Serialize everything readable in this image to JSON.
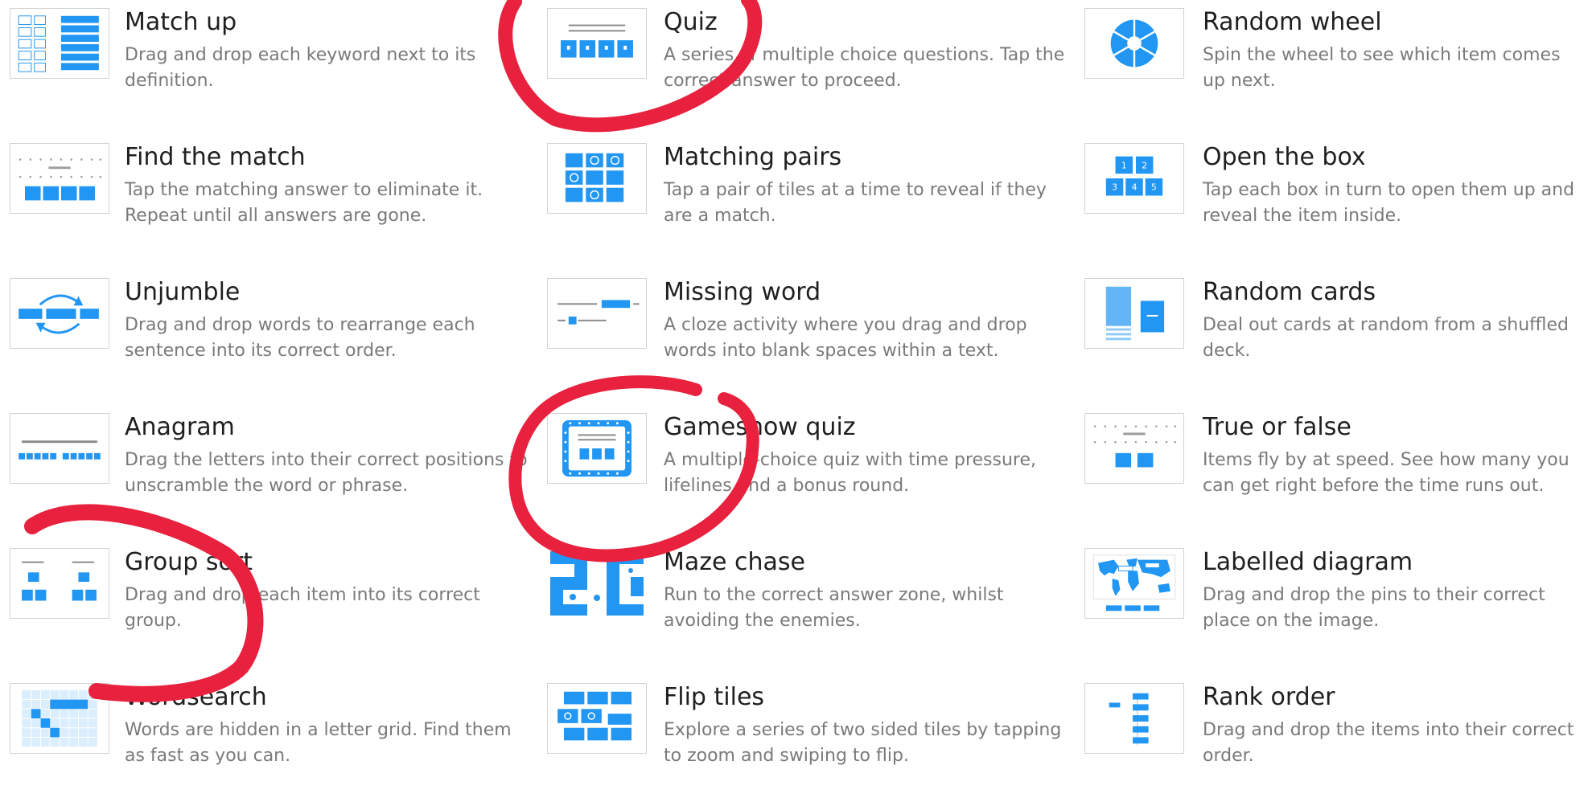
{
  "accent_color": "#2196f3",
  "annotation_color": "#e8213e",
  "templates": [
    {
      "title": "Match up",
      "description": "Drag and drop each keyword next to its definition.",
      "thumbnail": "match-up-thumbnail"
    },
    {
      "title": "Find the match",
      "description": "Tap the matching answer to eliminate it. Repeat until all answers are gone.",
      "thumbnail": "find-the-match-thumbnail"
    },
    {
      "title": "Unjumble",
      "description": "Drag and drop words to rearrange each sentence into its correct order.",
      "thumbnail": "unjumble-thumbnail"
    },
    {
      "title": "Anagram",
      "description": "Drag the letters into their correct positions to unscramble the word or phrase.",
      "thumbnail": "anagram-thumbnail"
    },
    {
      "title": "Group sort",
      "description": "Drag and drop each item into its correct group.",
      "thumbnail": "group-sort-thumbnail"
    },
    {
      "title": "Wordsearch",
      "description": "Words are hidden in a letter grid. Find them as fast as you can.",
      "thumbnail": "wordsearch-thumbnail"
    },
    {
      "title": "Quiz",
      "description": "A series of multiple choice questions. Tap the correct answer to proceed.",
      "thumbnail": "quiz-thumbnail"
    },
    {
      "title": "Matching pairs",
      "description": "Tap a pair of tiles at a time to reveal if they are a match.",
      "thumbnail": "matching-pairs-thumbnail"
    },
    {
      "title": "Missing word",
      "description": "A cloze activity where you drag and drop words into blank spaces within a text.",
      "thumbnail": "missing-word-thumbnail"
    },
    {
      "title": "Gameshow quiz",
      "description": "A multiple-choice quiz with time pressure, lifelines and a bonus round.",
      "thumbnail": "gameshow-quiz-thumbnail"
    },
    {
      "title": "Maze chase",
      "description": "Run to the correct answer zone, whilst avoiding the enemies.",
      "thumbnail": "maze-chase-thumbnail"
    },
    {
      "title": "Flip tiles",
      "description": "Explore a series of two sided tiles by tapping to zoom and swiping to flip.",
      "thumbnail": "flip-tiles-thumbnail"
    },
    {
      "title": "Random wheel",
      "description": "Spin the wheel to see which item comes up next.",
      "thumbnail": "random-wheel-thumbnail"
    },
    {
      "title": "Open the box",
      "description": "Tap each box in turn to open them up and reveal the item inside.",
      "thumbnail": "open-the-box-thumbnail",
      "box_numbers": [
        "1",
        "2",
        "3",
        "4",
        "5"
      ]
    },
    {
      "title": "Random cards",
      "description": "Deal out cards at random from a shuffled deck.",
      "thumbnail": "random-cards-thumbnail"
    },
    {
      "title": "True or false",
      "description": "Items fly by at speed. See how many you can get right before the time runs out.",
      "thumbnail": "true-or-false-thumbnail"
    },
    {
      "title": "Labelled diagram",
      "description": "Drag and drop the pins to their correct place on the image.",
      "thumbnail": "labelled-diagram-thumbnail"
    },
    {
      "title": "Rank order",
      "description": "Drag and drop the items into their correct order.",
      "thumbnail": "rank-order-thumbnail"
    }
  ]
}
